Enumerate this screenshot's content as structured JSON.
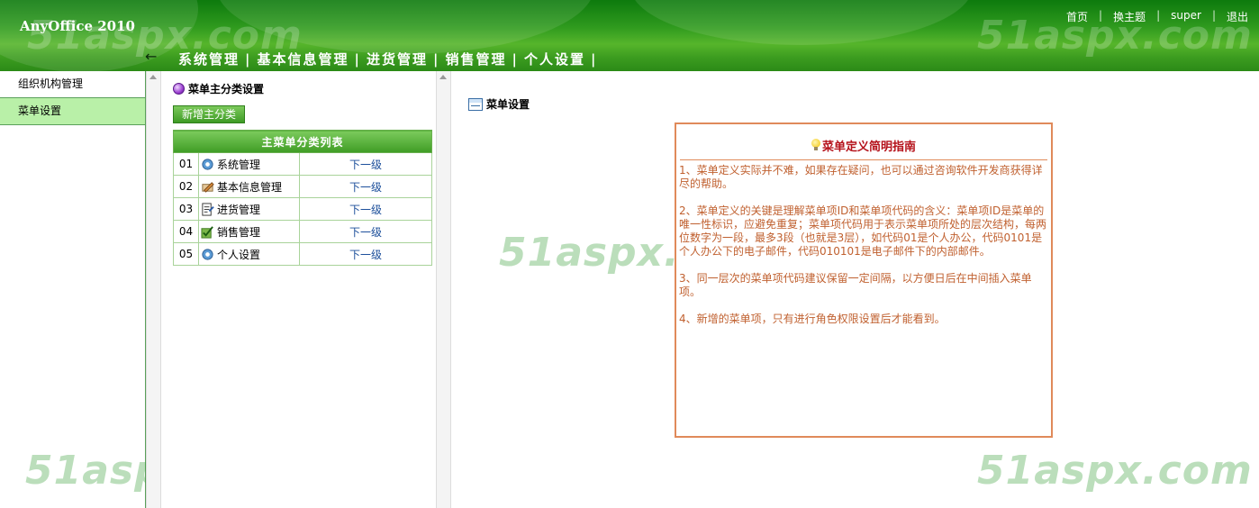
{
  "header": {
    "app_title": "AnyOffice 2010",
    "top_links": [
      "首页",
      "换主题",
      "super",
      "退出"
    ],
    "nav": [
      "系统管理",
      "基本信息管理",
      "进货管理",
      "销售管理",
      "个人设置"
    ],
    "watermark": "51aspx.com"
  },
  "sidebar": {
    "items": [
      {
        "label": "组织机构管理"
      },
      {
        "label": "菜单设置"
      }
    ]
  },
  "mid": {
    "heading": "菜单主分类设置",
    "add_button": "新增主分类",
    "table_header": "主菜单分类列表",
    "rows": [
      {
        "num": "01",
        "name": "系统管理",
        "link": "下一级",
        "icon": "gear-icon"
      },
      {
        "num": "02",
        "name": "基本信息管理",
        "link": "下一级",
        "icon": "pencil-icon"
      },
      {
        "num": "03",
        "name": "进货管理",
        "link": "下一级",
        "icon": "document-icon"
      },
      {
        "num": "04",
        "name": "销售管理",
        "link": "下一级",
        "icon": "check-icon"
      },
      {
        "num": "05",
        "name": "个人设置",
        "link": "下一级",
        "icon": "gear-icon"
      }
    ]
  },
  "content": {
    "title": "菜单设置",
    "guide": {
      "title": "菜单定义简明指南",
      "paragraphs": [
        "1、菜单定义实际并不难，如果存在疑问，也可以通过咨询软件开发商获得详尽的帮助。",
        "2、菜单定义的关键是理解菜单项ID和菜单项代码的含义：菜单项ID是菜单的唯一性标识，应避免重复；菜单项代码用于表示菜单项所处的层次结构，每两位数字为一段，最多3段（也就是3层），如代码01是个人办公，代码0101是个人办公下的电子邮件，代码010101是电子邮件下的内部邮件。",
        "3、同一层次的菜单项代码建议保留一定间隔，以方便日后在中间插入菜单项。",
        "4、新增的菜单项，只有进行角色权限设置后才能看到。"
      ]
    }
  },
  "colors": {
    "header_green": "#2f9a1e",
    "active_item": "#b9f0a8",
    "guide_border": "#e08a5a",
    "guide_text": "#c0602f",
    "guide_title": "#b5121b",
    "link_blue": "#1b4e9a"
  }
}
